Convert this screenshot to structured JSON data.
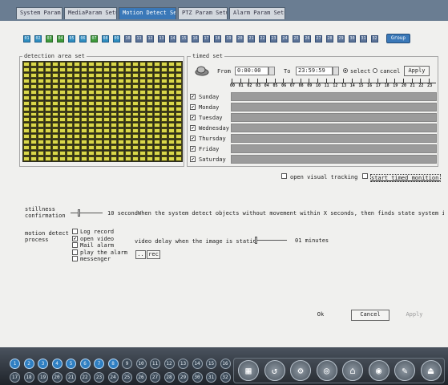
{
  "tabs": [
    {
      "label": "System Param",
      "active": false
    },
    {
      "label": "MediaParam Setup",
      "active": false
    },
    {
      "label": "Motion Detect Setup",
      "active": true
    },
    {
      "label": "PTZ Param Setup",
      "active": false
    },
    {
      "label": "Alarm Param Setup",
      "active": false
    }
  ],
  "channels": [
    "01",
    "02",
    "03",
    "04",
    "05",
    "06",
    "07",
    "08",
    "09",
    "10",
    "11",
    "12",
    "13",
    "14",
    "15",
    "16",
    "17",
    "18",
    "19",
    "20",
    "21",
    "22",
    "23",
    "24",
    "25",
    "26",
    "27",
    "28",
    "29",
    "30",
    "31",
    "32"
  ],
  "group_button": "Group",
  "detection": {
    "legend": "detection area set"
  },
  "timed": {
    "legend": "timed set",
    "from_label": "From",
    "from_value": "0:00:00",
    "to_label": "To",
    "to_value": "23:59:59",
    "select_label": "select",
    "cancel_label": "cancel",
    "apply_label": "Apply",
    "hours": [
      "00",
      "01",
      "02",
      "03",
      "04",
      "05",
      "06",
      "07",
      "08",
      "09",
      "10",
      "11",
      "12",
      "13",
      "14",
      "15",
      "16",
      "17",
      "18",
      "19",
      "20",
      "21",
      "22",
      "23"
    ],
    "days": [
      {
        "label": "Sunday",
        "checked": true
      },
      {
        "label": "Monday",
        "checked": true
      },
      {
        "label": "Tuesday",
        "checked": true
      },
      {
        "label": "Wednesday",
        "checked": true
      },
      {
        "label": "Thursday",
        "checked": true
      },
      {
        "label": "Friday",
        "checked": true
      },
      {
        "label": "Saturday",
        "checked": true
      }
    ]
  },
  "tracking": {
    "open_visual_label": "open visual tracking",
    "start_timed_label": "start timed monition d"
  },
  "stillness": {
    "label_line1": "stillness",
    "label_line2": "confirmation",
    "value_text": "10 second",
    "description": "When the system detect objects without movement within X seconds, then finds state system into"
  },
  "process": {
    "label_line1": "motion detect",
    "label_line2": "process",
    "options": [
      {
        "label": "Log record",
        "checked": false
      },
      {
        "label": "open video",
        "checked": true
      },
      {
        "label": "Mail alarm",
        "checked": false
      },
      {
        "label": "play the alarm",
        "checked": false
      },
      {
        "label": "messenger",
        "checked": false
      }
    ],
    "video_delay_label": "video delay when the image is static",
    "video_delay_value": "01 minutes",
    "browse_label": "..",
    "rec_label": "rec"
  },
  "buttons": {
    "ok": "Ok",
    "cancel": "Cancel",
    "apply": "Apply"
  },
  "bottom_numbers": [
    "1",
    "2",
    "3",
    "4",
    "5",
    "6",
    "7",
    "8",
    "9",
    "10",
    "11",
    "12",
    "13",
    "14",
    "15",
    "16",
    "17",
    "18",
    "19",
    "20",
    "21",
    "22",
    "23",
    "24",
    "25",
    "26",
    "27",
    "28",
    "29",
    "30",
    "31",
    "32"
  ],
  "bottom_controls": [
    "layout-icon",
    "rewind-icon",
    "settings-icon",
    "grid-icon",
    "home-icon",
    "record-icon",
    "edit-icon",
    "exit-icon"
  ]
}
